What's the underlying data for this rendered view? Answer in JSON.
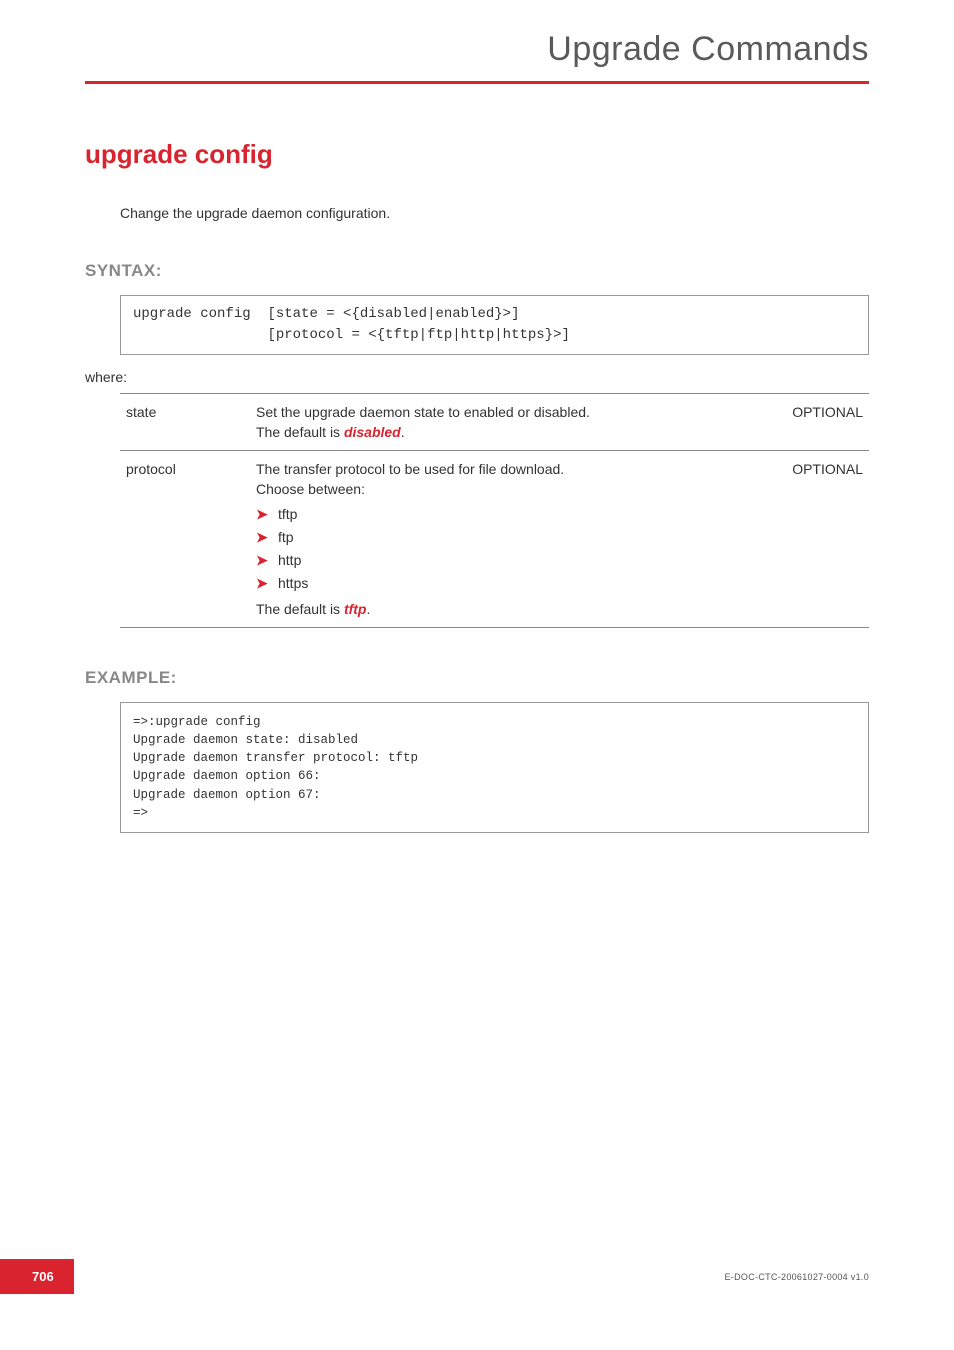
{
  "header": {
    "title": "Upgrade Commands"
  },
  "section": {
    "title": "upgrade config",
    "description": "Change the upgrade daemon configuration."
  },
  "syntax": {
    "heading": "SYNTAX:",
    "command": "upgrade config",
    "args": "[state = <{disabled|enabled}>]\n[protocol = <{tftp|ftp|http|https}>]",
    "where": "where:",
    "params": [
      {
        "name": "state",
        "desc": "Set the upgrade daemon state to enabled or disabled.",
        "default_prefix": "The default is ",
        "default_value": "disabled",
        "default_suffix": ".",
        "options": [],
        "optional": "OPTIONAL"
      },
      {
        "name": "protocol",
        "desc": "The transfer protocol to be used for file download.",
        "choose_label": "Choose between:",
        "options": [
          "tftp",
          "ftp",
          "http",
          "https"
        ],
        "default_prefix": "The default is ",
        "default_value": "tftp",
        "default_suffix": ".",
        "optional": "OPTIONAL"
      }
    ]
  },
  "example": {
    "heading": "EXAMPLE:",
    "output": "=>:upgrade config\nUpgrade daemon state: disabled\nUpgrade daemon transfer protocol: tftp\nUpgrade daemon option 66:\nUpgrade daemon option 67:\n=>"
  },
  "footer": {
    "page": "706",
    "doc": "E-DOC-CTC-20061027-0004 v1.0"
  }
}
